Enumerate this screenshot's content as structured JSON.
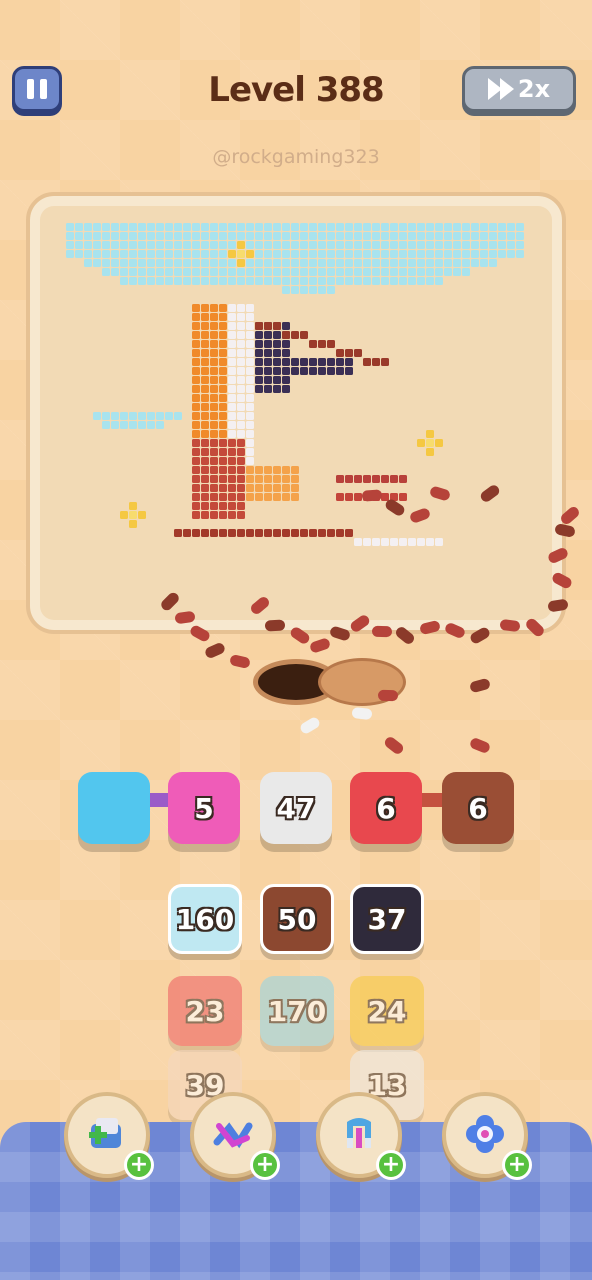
{
  "header": {
    "level_title": "Level 388",
    "watermark": "@rockgaming323",
    "speed_label": "2x"
  },
  "queue_tiles": [
    {
      "value": "",
      "color": "#52c6ee",
      "bind": "queue_tiles.0.value"
    },
    {
      "value": "5",
      "color": "#ef5cb8"
    },
    {
      "value": "47",
      "color": "#e9e9e9"
    },
    {
      "value": "6",
      "color": "#e8484e"
    },
    {
      "value": "6",
      "color": "#9a4e35"
    }
  ],
  "grid_tiles": [
    {
      "value": "160",
      "color": "#bfe8f2",
      "dim": false
    },
    {
      "value": "50",
      "color": "#8c4830",
      "dim": false
    },
    {
      "value": "37",
      "color": "#2f2a3b",
      "dim": false
    },
    {
      "value": "23",
      "color": "#ee5a60",
      "dim": true
    },
    {
      "value": "170",
      "color": "#8fd6ea",
      "dim": true
    },
    {
      "value": "24",
      "color": "#f7c93a",
      "dim": true
    },
    {
      "value": "39",
      "color": "#f4d8c2",
      "dim": true
    },
    {
      "value": "13",
      "color": "#eeeeee",
      "dim": true
    }
  ],
  "boosters": [
    {
      "name": "add-slot-booster"
    },
    {
      "name": "shuffle-booster"
    },
    {
      "name": "magnet-booster"
    },
    {
      "name": "freeze-booster"
    }
  ],
  "colors": {
    "background": "#f8d3a2",
    "board": "#f2dab5",
    "bottom_bar": "#6e86d4",
    "accent_text": "#5b2d17"
  }
}
